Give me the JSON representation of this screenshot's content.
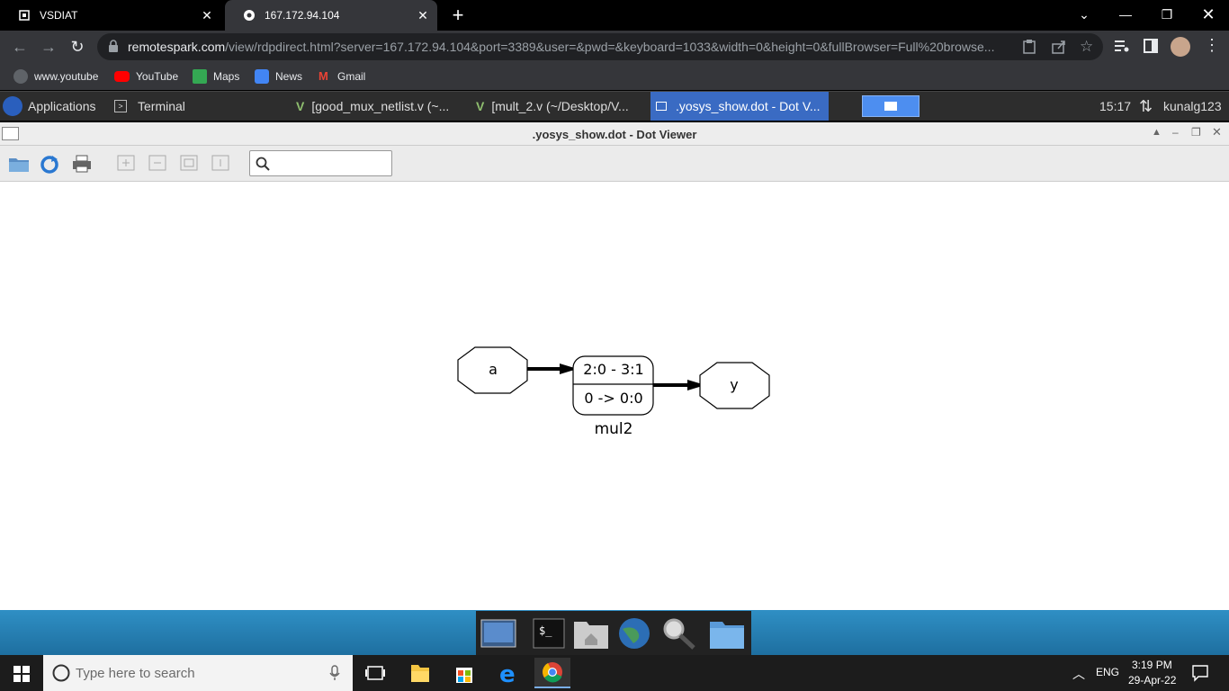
{
  "browser": {
    "tabs": [
      {
        "title": "VSDIAT",
        "active": false
      },
      {
        "title": "167.172.94.104",
        "active": true
      }
    ],
    "url_host": "remotespark.com",
    "url_path": "/view/rdpdirect.html?server=167.172.94.104&port=3389&user=&pwd=&keyboard=1033&width=0&height=0&fullBrowser=Full%20browse...",
    "bookmarks": [
      {
        "label": "www.youtube"
      },
      {
        "label": "YouTube"
      },
      {
        "label": "Maps"
      },
      {
        "label": "News"
      },
      {
        "label": "Gmail"
      }
    ]
  },
  "xfce_panel": {
    "applications_label": "Applications",
    "tasks": [
      {
        "label": "Terminal"
      },
      {
        "label": "[good_mux_netlist.v (~..."
      },
      {
        "label": "[mult_2.v (~/Desktop/V..."
      },
      {
        "label": ".yosys_show.dot - Dot V..."
      }
    ],
    "clock": "15:17",
    "user": "kunalg123"
  },
  "dot_viewer": {
    "title": ".yosys_show.dot - Dot Viewer",
    "search_placeholder": ""
  },
  "graph": {
    "input_node": "a",
    "cell_top": "2:0 - 3:1",
    "cell_bottom": "0 -> 0:0",
    "cell_name": "mul2",
    "output_node": "y"
  },
  "taskbar": {
    "search_placeholder": "Type here to search",
    "lang": "ENG",
    "time": "3:19 PM",
    "date": "29-Apr-22"
  },
  "colors": {
    "chrome_dark": "#35363a",
    "panel_active": "#3a6bc3",
    "dock_blue": "#2f8fc4"
  }
}
